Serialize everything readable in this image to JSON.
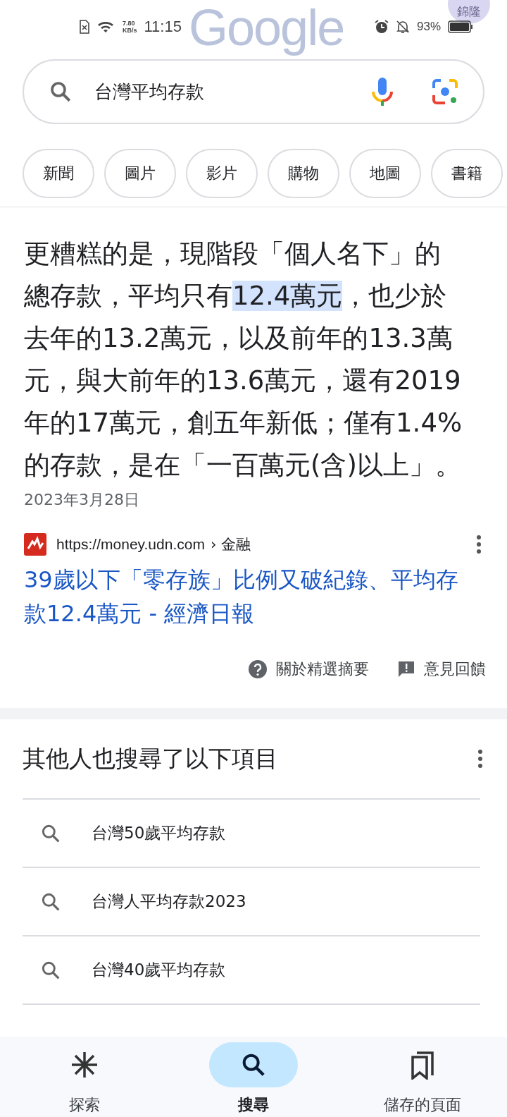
{
  "status_bar": {
    "net_speed_value": "7.80",
    "net_speed_unit": "KB/s",
    "time": "11:15",
    "battery": "93%"
  },
  "header": {
    "logo": "Google",
    "avatar": "錦隆"
  },
  "search": {
    "value": "台灣平均存款"
  },
  "chips": [
    {
      "label": "新聞"
    },
    {
      "label": "圖片"
    },
    {
      "label": "影片"
    },
    {
      "label": "購物"
    },
    {
      "label": "地圖"
    },
    {
      "label": "書籍"
    }
  ],
  "snippet": {
    "parts": [
      {
        "text": "更糟糕的是，現階段「個人名下」的總存款，平均只有",
        "highlighted": false
      },
      {
        "text": "12.4萬元",
        "highlighted": true
      },
      {
        "text": "，也少於去年的13.2萬元，以及前年的13.3萬元，與大前年的13.6萬元，還有2019年的17萬元，創五年新低；僅有1.4%的存款，是在「一百萬元(含)以上」。",
        "highlighted": false
      }
    ],
    "date": "2023年3月28日",
    "source_url": "https://money.udn.com",
    "source_path": "› 金融",
    "title": "39歲以下「零存族」比例又破紀錄、平均存款12.4萬元 - 經濟日報",
    "about": "關於精選摘要",
    "feedback": "意見回饋"
  },
  "related": {
    "heading": "其他人也搜尋了以下項目",
    "items": [
      {
        "label": "台灣50歲平均存款"
      },
      {
        "label": "台灣人平均存款2023"
      },
      {
        "label": "台灣40歲平均存款"
      }
    ]
  },
  "bottom_nav": [
    {
      "label": "探索",
      "kind": "explore",
      "selected": false
    },
    {
      "label": "搜尋",
      "kind": "search",
      "selected": true
    },
    {
      "label": "儲存的頁面",
      "kind": "saved",
      "selected": false
    }
  ]
}
